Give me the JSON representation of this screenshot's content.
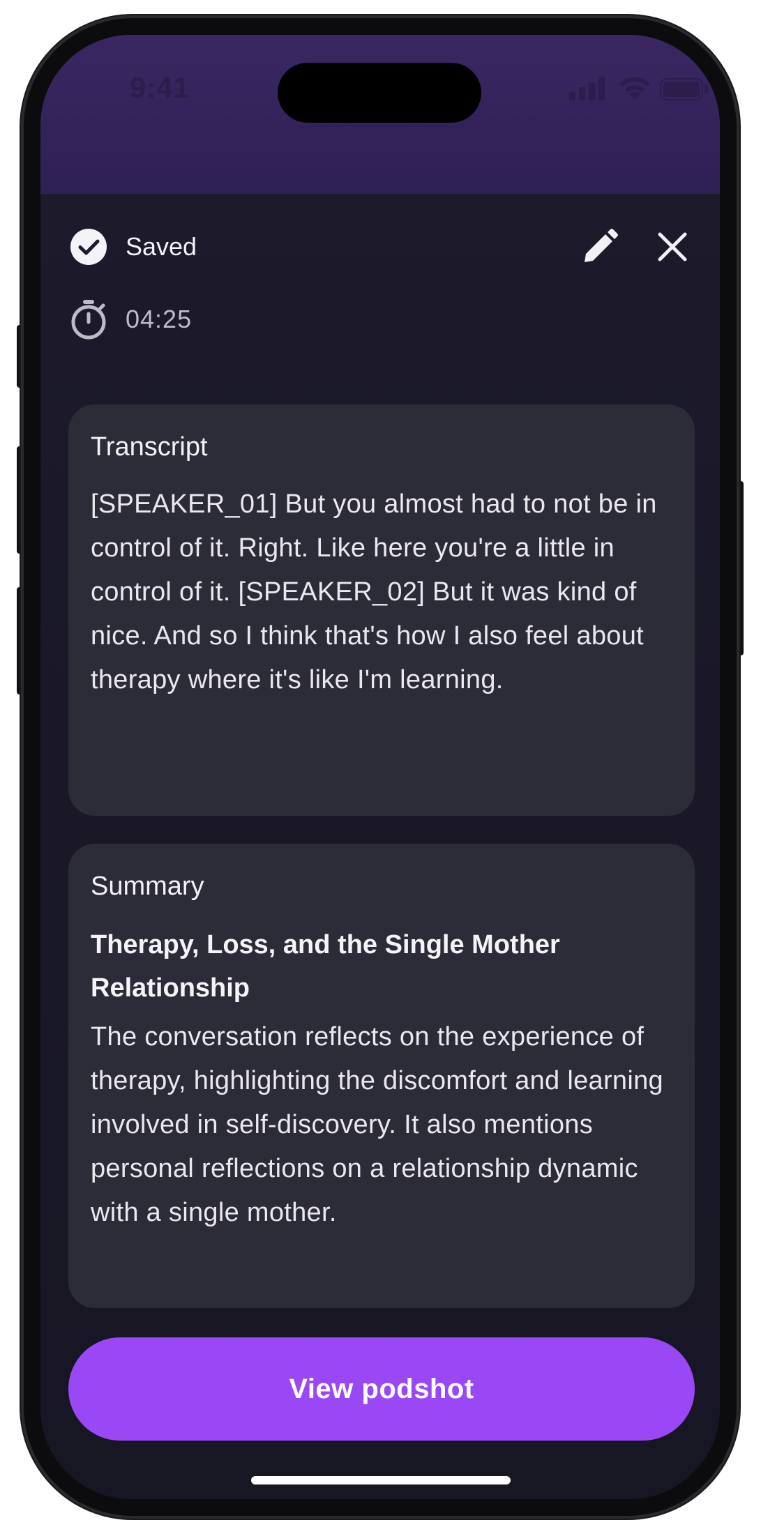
{
  "status_bar": {
    "time": "9:41",
    "icons": [
      "cellular-signal-icon",
      "wifi-icon",
      "battery-icon"
    ]
  },
  "header": {
    "status_label": "Saved",
    "status_icon": "check-circle-icon",
    "actions": [
      "edit-pencil-icon",
      "close-icon"
    ]
  },
  "timer": {
    "icon": "stopwatch-icon",
    "duration": "04:25"
  },
  "transcript": {
    "heading": "Transcript",
    "text": "[SPEAKER_01] But you almost had to not be in control of it. Right. Like here you're a little in control of it. [SPEAKER_02] But it was kind of nice. And so I think that's how I also feel about therapy where it's like I'm learning."
  },
  "summary": {
    "heading": "Summary",
    "title": "Therapy, Loss, and the Single Mother Relationship",
    "text": "The conversation reflects on the experience of therapy, highlighting the discomfort and learning involved in self-discovery. It also mentions personal reflections on a relationship dynamic with a single mother."
  },
  "cta": {
    "label": "View podshot"
  },
  "colors": {
    "accent": "#9A48F6",
    "background": "#1B1A26",
    "card": "#2C2B38",
    "status_area": "#33235B"
  }
}
